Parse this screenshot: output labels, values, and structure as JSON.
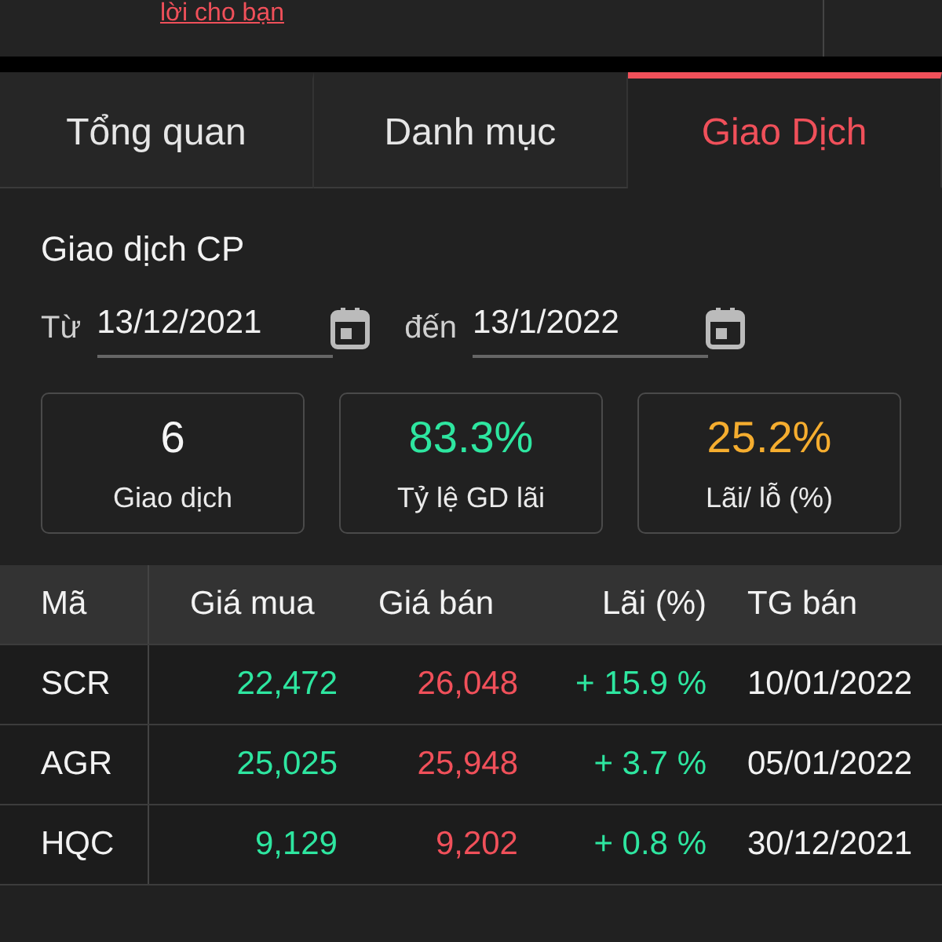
{
  "top_link": "lời cho bạn",
  "tabs": [
    {
      "label": "Tổng quan",
      "selected": false
    },
    {
      "label": "Danh mục",
      "selected": false
    },
    {
      "label": "Giao Dịch",
      "selected": true
    }
  ],
  "section_title": "Giao dịch CP",
  "date_range": {
    "from_label": "Từ",
    "from_value": "13/12/2021",
    "to_label": "đến",
    "to_value": "13/1/2022"
  },
  "stats": [
    {
      "value": "6",
      "label": "Giao dịch",
      "color": "#f5f5f5"
    },
    {
      "value": "83.3%",
      "label": "Tỷ lệ GD lãi",
      "color": "#2ee6a0"
    },
    {
      "value": "25.2%",
      "label": "Lãi/ lỗ (%)",
      "color": "#f5ad2f"
    }
  ],
  "table": {
    "columns": [
      "Mã",
      "Giá mua",
      "Giá bán",
      "Lãi (%)",
      "TG bán"
    ],
    "rows": [
      {
        "code": "SCR",
        "buy": "22,472",
        "sell": "26,048",
        "profit": "+ 15.9 %",
        "profit_up": true,
        "sold_at": "10/01/2022"
      },
      {
        "code": "AGR",
        "buy": "25,025",
        "sell": "25,948",
        "profit": "+ 3.7 %",
        "profit_up": true,
        "sold_at": "05/01/2022"
      },
      {
        "code": "HQC",
        "buy": "9,129",
        "sell": "9,202",
        "profit": "+ 0.8 %",
        "profit_up": true,
        "sold_at": "30/12/2021"
      }
    ]
  }
}
